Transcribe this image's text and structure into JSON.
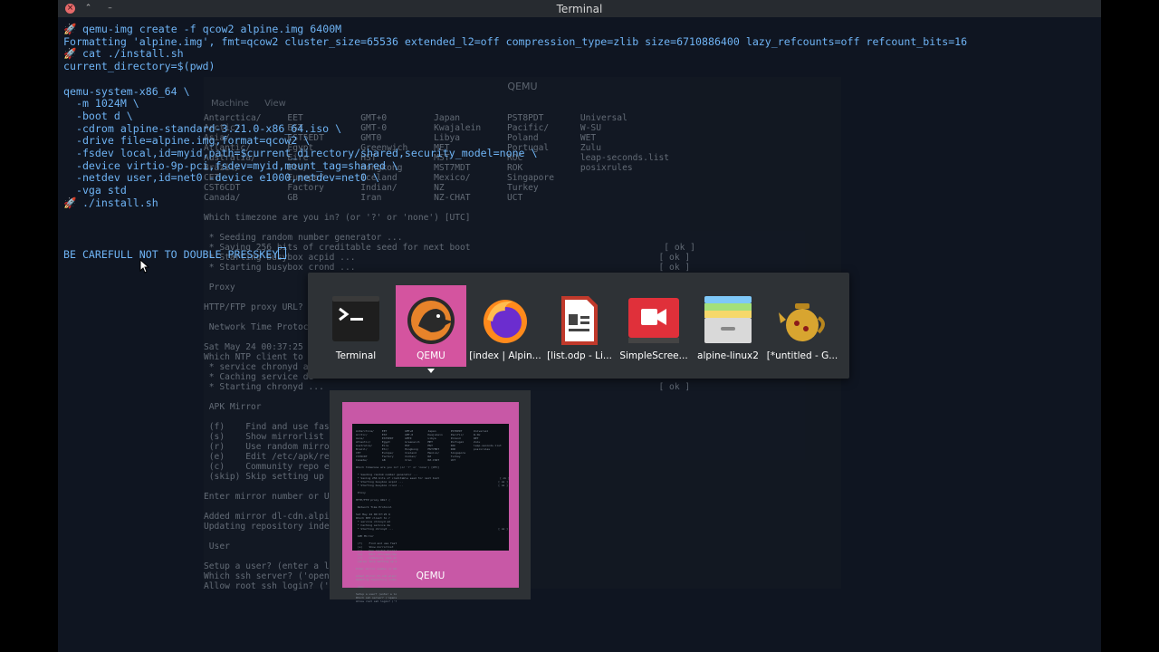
{
  "window": {
    "title": "Terminal",
    "close": "×",
    "max": "⌃",
    "min": "–"
  },
  "terminal": {
    "lines": [
      {
        "prompt": true,
        "text": "qemu-img create -f qcow2 alpine.img 6400M"
      },
      {
        "prompt": false,
        "text": "Formatting 'alpine.img', fmt=qcow2 cluster_size=65536 extended_l2=off compression_type=zlib size=6710886400 lazy_refcounts=off refcount_bits=16"
      },
      {
        "prompt": true,
        "text": "cat ./install.sh"
      },
      {
        "prompt": false,
        "text": "current_directory=$(pwd)"
      },
      {
        "prompt": false,
        "text": ""
      },
      {
        "prompt": false,
        "text": "qemu-system-x86_64 \\"
      },
      {
        "prompt": false,
        "text": "  -m 1024M \\"
      },
      {
        "prompt": false,
        "text": "  -boot d \\"
      },
      {
        "prompt": false,
        "text": "  -cdrom alpine-standard-3.21.0-x86_64.iso \\"
      },
      {
        "prompt": false,
        "text": "  -drive file=alpine.img,format=qcow2 \\"
      },
      {
        "prompt": false,
        "text": "  -fsdev local,id=myid,path=$current_directory/shared,security_model=none \\"
      },
      {
        "prompt": false,
        "text": "  -device virtio-9p-pci,fsdev=myid,mount_tag=shared \\"
      },
      {
        "prompt": false,
        "text": "  -netdev user,id=net0 -device e1000,netdev=net0 \\"
      },
      {
        "prompt": false,
        "text": "  -vga std"
      },
      {
        "prompt": true,
        "text": "./install.sh"
      },
      {
        "prompt": false,
        "text": ""
      },
      {
        "prompt": false,
        "text": ""
      },
      {
        "prompt": false,
        "text": ""
      },
      {
        "prompt": false,
        "text": "BE CAREFULL NOT TO DOUBLE PRESSKEY"
      }
    ],
    "prompt_glyph": "🚀",
    "colors": {
      "text": "#6fb4f5",
      "bg": "#0f1521"
    }
  },
  "qemu": {
    "title": "QEMU",
    "menu": [
      "Machine",
      "View"
    ],
    "text": "Antarctica/     EET           GMT+0         Japan         PST8PDT       Universal\nArctic/         EST           GMT-0         Kwajalein     Pacific/      W-SU\nAsia/           EST5EDT       GMT0          Libya         Poland        WET\nAtlantic/       Egypt         Greenwich     MET           Portugal      Zulu\nAustralia/      Eire          HST           MST           ROC           leap-seconds.list\nBrazil/         Etc/          Hongkong      MST7MDT       ROK           posixrules\nCET             Europe/       Iceland       Mexico/       Singapore\nCST6CDT         Factory       Indian/       NZ            Turkey\nCanada/         GB            Iran          NZ-CHAT       UCT\n\nWhich timezone are you in? (or '?' or 'none') [UTC]\n\n * Seeding random number generator ...\n * Saving 256 bits of creditable seed for next boot                                     [ ok ]\n * Starting busybox acpid ...                                                          [ ok ]\n * Starting busybox crond ...                                                          [ ok ]\n\n Proxy\n\nHTTP/FTP proxy URL? (\n\n Network Time Protocol\n\nSat May 24 00:37:25 U\nWhich NTP client to r\n * service chronyd ad\n * Caching service de\n * Starting chronyd ...                                                                [ ok ]\n\n APK Mirror\n\n (f)    Find and use fast\n (s)    Show mirrorlist\n (r)    Use random mirror\n (e)    Edit /etc/apk/rep\n (c)    Community repo en\n (skip) Skip setting up a\n\nEnter mirror number or UR\n\nAdded mirror dl-cdn.alpin\nUpdating repository index\n\n User\n\nSetup a user? (enter a lo\nWhich ssh server? ('opens\nAllow root ssh login? ('?"
  },
  "switcher": {
    "items": [
      {
        "label": "Terminal",
        "icon": "terminal-icon"
      },
      {
        "label": "QEMU",
        "icon": "qemu-icon",
        "selected": true
      },
      {
        "label": "[index | Alpin...",
        "icon": "firefox-icon"
      },
      {
        "label": "[list.odp - Li...",
        "icon": "impress-icon"
      },
      {
        "label": "SimpleScree...",
        "icon": "screenrecorder-icon"
      },
      {
        "label": "alpine-linux2",
        "icon": "archive-icon"
      },
      {
        "label": "[*untitled - G...",
        "icon": "teapot-icon"
      }
    ],
    "preview_label": "QEMU"
  }
}
